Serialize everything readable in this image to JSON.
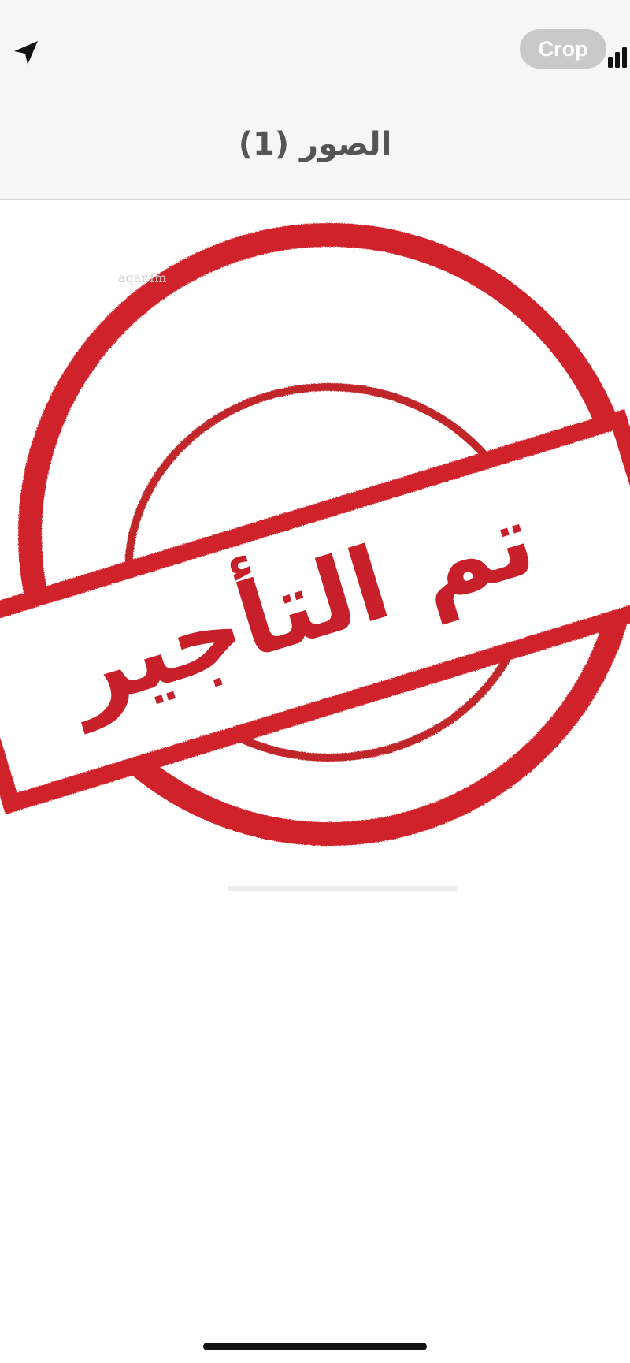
{
  "status_bar": {
    "crop_label": "Crop",
    "location_icon": "location-arrow-icon",
    "signal_icon": "cellular-signal-icon"
  },
  "nav": {
    "title": "الصور (1)"
  },
  "photo": {
    "stamp_text": "تم التأجير",
    "watermark_text": "aqar.fm",
    "stamp_color": "#d0202a"
  }
}
